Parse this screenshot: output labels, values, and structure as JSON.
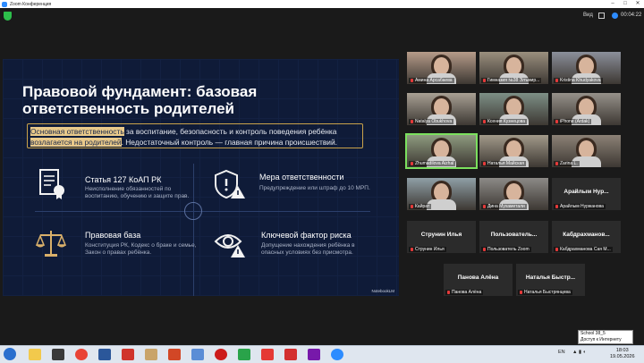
{
  "window": {
    "title": "Zoom Конференция"
  },
  "topbar": {
    "view_label": "Вид",
    "timer": "00:04:22"
  },
  "slide": {
    "title": "Правовой фундамент: базовая ответственность родителей",
    "intro_highlight1": "Основная ответственность",
    "intro_rest1": " за воспитание, безопасность и контроль поведения ребёнка",
    "intro_highlight2": "возлагается на родителей",
    "intro_rest2": ". Недостаточный контроль — главная причина происшествий.",
    "cards": [
      {
        "title": "Статья 127 КоАП РК",
        "desc": "Неисполнение обязанностей по воспитанию, обучению и защите прав.",
        "icon": "document-seal-icon"
      },
      {
        "title": "Мера ответственности",
        "desc": "Предупреждение или штраф до 10 МРП.",
        "icon": "shield-warning-icon"
      },
      {
        "title": "Правовая база",
        "desc": "Конституция РК, Кодекс о браке и семье, Закон о правах ребёнка.",
        "icon": "scales-icon"
      },
      {
        "title": "Ключевой фактор риска",
        "desc": "Допущение нахождения ребёнка в опасных условиях без присмотра.",
        "icon": "eye-warning-icon"
      }
    ],
    "footer": "NotebookLM"
  },
  "participants": [
    {
      "name": "Амина Арсабаева",
      "big": "",
      "video": true
    },
    {
      "name": "Гимназия №38 Элъмир...",
      "big": "",
      "video": true
    },
    {
      "name": "Kristina Khudyakova",
      "big": "",
      "video": true
    },
    {
      "name": "Natalya Obukhova",
      "big": "",
      "video": true
    },
    {
      "name": "Ксения Кузнецова",
      "big": "",
      "video": true
    },
    {
      "name": "iPhone (Ardak)",
      "big": "",
      "video": true
    },
    {
      "name": "Zhumadilova Aizhal",
      "big": "",
      "video": true,
      "active": true
    },
    {
      "name": "Наталья Майская",
      "big": "",
      "video": true
    },
    {
      "name": "Zarina L.",
      "big": "",
      "video": true
    },
    {
      "name": "Кайрат",
      "big": "",
      "video": true
    },
    {
      "name": "Дина Мухаметали",
      "big": "",
      "video": true
    },
    {
      "name": "Арайлым Нуржанова",
      "big": "Арайлым Нур...",
      "video": false
    },
    {
      "name": "Струнин Илья",
      "big": "Струнин Илья",
      "video": false
    },
    {
      "name": "Пользователь Zoom",
      "big": "Пользователь...",
      "video": false
    },
    {
      "name": "Кабдрахманова Сая М...",
      "big": "Кабдрахманов...",
      "video": false
    },
    {
      "name": "Панова Алёна",
      "big": "Панова Алёна",
      "video": false
    },
    {
      "name": "Наталья Быстрянцева",
      "big": "Наталья Быстр...",
      "video": false
    }
  ],
  "taskbar": {
    "lang": "EN",
    "time": "18:03",
    "date": "19.05.2026",
    "apps": [
      "explorer-icon",
      "game-icon",
      "chrome-icon",
      "word-icon",
      "yandex-icon",
      "photos-icon",
      "powerpoint-icon",
      "paint-icon",
      "opera-icon",
      "video-icon",
      "yandex-browser-icon",
      "pdf-icon",
      "onenote-icon",
      "zoom-icon"
    ]
  },
  "tooltip": {
    "line1": "School 38_5",
    "line2": "Доступ к Интернету"
  },
  "colors": {
    "zoom_blue": "#2d8cff",
    "slide_bg": "#0f1b38",
    "highlight": "#e9c98a",
    "active_speaker": "#7be05e"
  }
}
